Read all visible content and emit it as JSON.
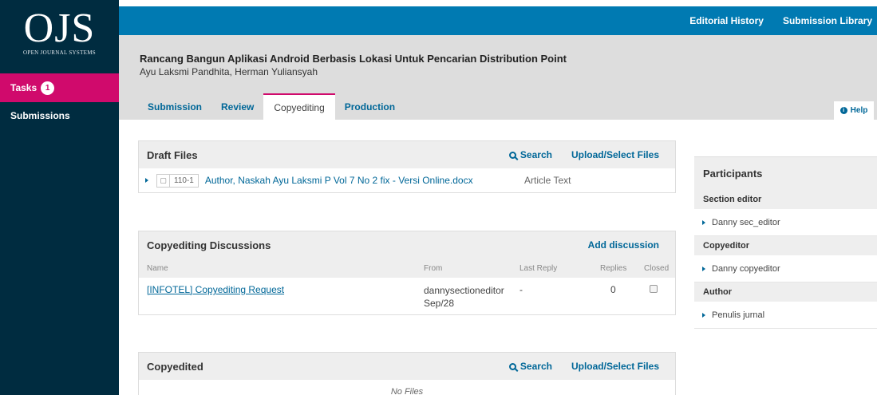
{
  "brand": {
    "logo_text": "OJS",
    "logo_sub": "OPEN JOURNAL SYSTEMS"
  },
  "sidebar": {
    "tasks_label": "Tasks",
    "tasks_count": "1",
    "submissions_label": "Submissions"
  },
  "topbar": {
    "editorial_history": "Editorial History",
    "submission_library": "Submission Library"
  },
  "submission": {
    "title": "Rancang Bangun Aplikasi Android Berbasis Lokasi Untuk Pencarian Distribution Point",
    "authors": "Ayu Laksmi Pandhita, Herman Yuliansyah"
  },
  "tabs": [
    {
      "label": "Submission"
    },
    {
      "label": "Review"
    },
    {
      "label": "Copyediting"
    },
    {
      "label": "Production"
    }
  ],
  "help": {
    "label": "Help"
  },
  "draft_files": {
    "title": "Draft Files",
    "search_label": "Search",
    "upload_label": "Upload/Select Files",
    "files": [
      {
        "id": "110-1",
        "name": "Author, Naskah Ayu Laksmi P Vol 7 No 2 fix - Versi Online.docx",
        "type": "Article Text"
      }
    ]
  },
  "discussions": {
    "title": "Copyediting Discussions",
    "add_label": "Add discussion",
    "columns": {
      "name": "Name",
      "from": "From",
      "last_reply": "Last Reply",
      "replies": "Replies",
      "closed": "Closed"
    },
    "rows": [
      {
        "name": "[INFOTEL] Copyediting Request",
        "from_user": "dannysectioneditor",
        "from_date": "Sep/28",
        "last_reply": "-",
        "replies": "0",
        "closed": false
      }
    ]
  },
  "copyedited": {
    "title": "Copyedited",
    "search_label": "Search",
    "upload_label": "Upload/Select Files",
    "empty_text": "No Files"
  },
  "participants": {
    "title": "Participants",
    "groups": [
      {
        "role": "Section editor",
        "person": "Danny sec_editor"
      },
      {
        "role": "Copyeditor",
        "person": "Danny copyeditor"
      },
      {
        "role": "Author",
        "person": "Penulis jurnal"
      }
    ]
  },
  "colors": {
    "sidebar": "#002c40",
    "topbar": "#007ab2",
    "accent": "#d00a6c",
    "link": "#006798"
  }
}
